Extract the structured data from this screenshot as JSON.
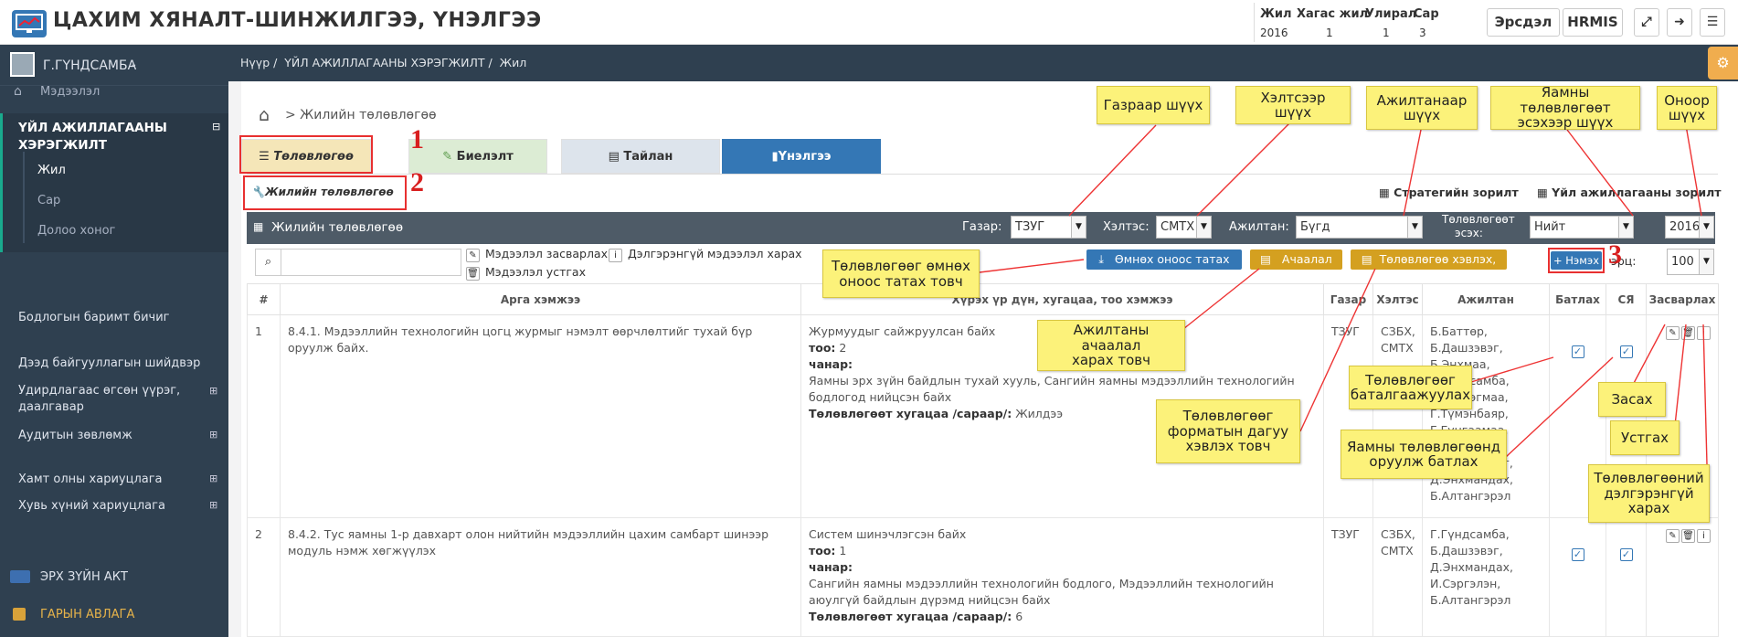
{
  "app": {
    "title": "ЦАХИМ ХЯНАЛТ-ШИНЖИЛГЭЭ, ҮНЭЛГЭЭ"
  },
  "period": {
    "headers": [
      "Жил",
      "Хагас жил",
      "Улирал",
      "Сар"
    ],
    "values": [
      "2016",
      "1",
      "1",
      "3"
    ]
  },
  "top_buttons": {
    "risk": "Эрсдэл",
    "hrmis": "HRMIS"
  },
  "user": {
    "name": "Г.ГҮНДСАМБА"
  },
  "sidebar": {
    "info": "Мэдээлэл",
    "activity_line1": "ҮЙЛ АЖИЛЛАГААНЫ",
    "activity_line2": "ХЭРЭГЖИЛТ",
    "year": "Жил",
    "month": "Сар",
    "week": "Долоо хоног",
    "docs": "Бодлогын баримт бичиг",
    "superior": "Дээд байгууллагын шийдвэр",
    "assign_line1": "Удирдлагаас өгсөн үүрэг,",
    "assign_line2": "даалгавар",
    "audit": "Аудитын зөвлөмж",
    "collective": "Хамт олны хариуцлага",
    "individual": "Хувь хүний хариуцлага",
    "legal": "ЭРХ ЗҮЙН АКТ",
    "handbook": "ГАРЫН АВЛАГА"
  },
  "breadcrumb": {
    "home": "Нүүр",
    "section": "ҮЙЛ АЖИЛЛАГААНЫ ХЭРЭГЖИЛТ",
    "current": "Жил"
  },
  "page": {
    "title": "> Жилийн төлөвлөгөө"
  },
  "tabs": {
    "plan": "Төлөвлөгөө",
    "execution": "Биелэлт",
    "report": "Тайлан",
    "evaluation": "Үнэлгээ"
  },
  "subtab": "Жилийн төлөвлөгөө",
  "goals": {
    "strategic": "Стратегийн зорилт",
    "activity": "Үйл ажиллагааны зорилт"
  },
  "filter": {
    "title": "Жилийн төлөвлөгөө",
    "place_label": "Газар:",
    "place_value": "ТЗУГ",
    "unit_label": "Хэлтэс:",
    "unit_value": "СМТХ",
    "employee_label": "Ажилтан:",
    "employee_value": "Бүгд",
    "status_label_1": "Төлөвлөгөөт",
    "status_label_2": "эсэх:",
    "status_value": "Нийт",
    "year_value": "2016"
  },
  "toolbar": {
    "edit_info": "Мэдээлэл засварлах",
    "delete_info": "Мэдээлэл устгах",
    "detail_info": "Дэлгэрэнгүй мэдээлэл харах",
    "pull_previous": "Өмнөх оноос татах",
    "workload": "Ачаалал",
    "print_plan": "Төлөвлөгөө хэвлэх, татах",
    "add": "Нэмэх",
    "page_size_label": "Харц:",
    "page_size_visible": "эрц:",
    "page_size": "100"
  },
  "table": {
    "headers": [
      "#",
      "Арга хэмжээ",
      "Хүрэх үр дүн, хугацаа, тоо хэмжээ",
      "Газар",
      "Хэлтэс",
      "Ажилтан",
      "Батлах",
      "СЯ",
      "Засварлах"
    ],
    "rows": [
      {
        "num": "1",
        "measure": "8.4.1. Мэдээллийн технологийн цогц журмыг нэмэлт өөрчлөлтийг тухай бүр оруулж байх.",
        "result": "Журмуудыг сайжруулсан байх",
        "qty_label": "тоо:",
        "qty": "2",
        "quality_label": "чанар:",
        "quality": "Яамны эрх зүйн байдлын тухай хууль, Сангийн яамны мэдээллийн технологийн бодлогод нийцсэн байх",
        "deadline_label": "Төлөвлөгөөт хугацаа /сараар/:",
        "deadline": "Жилдээ",
        "place": "ТЗУГ",
        "unit_1": "СЗБХ,",
        "unit_2": "СМТХ",
        "employees": [
          "Б.Баттөр,",
          "Б.Дашзэвэг,",
          "Б.Энхмаа,",
          "Г.Гүндсамба,",
          "Г.Гүндэгмаа,",
          "Г.Түмэнбаяр,",
          "Г.Гунгаамаа,",
          "Д.Дашзэвэг,",
          "Д.Оюунбилэг,",
          "Д.Энхмандах,",
          "Б.Алтангэрэл"
        ],
        "approve": true,
        "ministry": true
      },
      {
        "num": "2",
        "measure": "8.4.2. Тус яамны 1-р давхарт олон нийтийн мэдээллийн цахим самбарт шинээр модуль нэмж хөгжүүлэх",
        "result": "Систем шинэчлэгсэн байх",
        "qty_label": "тоо:",
        "qty": "1",
        "quality_label": "чанар:",
        "quality": "Сангийн яамны мэдээллийн технологийн бодлого, Мэдээллийн технологийн аюулгүй байдлын дүрэмд нийцсэн байх",
        "deadline_label": "Төлөвлөгөөт хугацаа /сараар/:",
        "deadline": "6",
        "place": "ТЗУГ",
        "unit_1": "СЗБХ,",
        "unit_2": "СМТХ",
        "employees": [
          "Г.Гүндсамба,",
          "Б.Дашзэвэг,",
          "Д.Энхмандах,",
          "И.Сэргэлэн,",
          "Б.Алтангэрэл"
        ],
        "approve": true,
        "ministry": true
      }
    ]
  },
  "annotations": {
    "by_place": "Газраар шүүх",
    "by_unit": "Хэлтсээр шүүх",
    "by_employee_1": "Ажилтанаар",
    "by_employee_2": "шүүх",
    "by_ministry_1": "Яамны төлөвлөгөөт",
    "by_ministry_2": "эсэхээр шүүх",
    "by_year_1": "Оноор",
    "by_year_2": "шүүх",
    "pull_1": "Төлөвлөгөөг өмнөх",
    "pull_2": "оноос татах товч",
    "load_1": "Ажилтаны ачаалал",
    "load_2": "харах товч",
    "confirm_1": "Төлөвлөгөөг",
    "confirm_2": "баталгаажуулах",
    "edit": "Засах",
    "format_1": "Төлөвлөгөөг",
    "format_2": "форматын дагуу",
    "format_3": "хэвлэх товч",
    "ministry_1": "Яамны төлөвлөгөөнд",
    "ministry_2": "оруулж батлах",
    "delete": "Устгах",
    "detail_1": "Төлөвлөгөөний",
    "detail_2": "дэлгэрэнгүй",
    "detail_3": "харах",
    "num1": "1",
    "num2": "2",
    "num3": "3"
  },
  "colors": {
    "sidebar": "#2f4050",
    "primary": "#3477b5",
    "warning": "#d4a020",
    "danger": "#e83030",
    "note": "#fcf27a"
  }
}
